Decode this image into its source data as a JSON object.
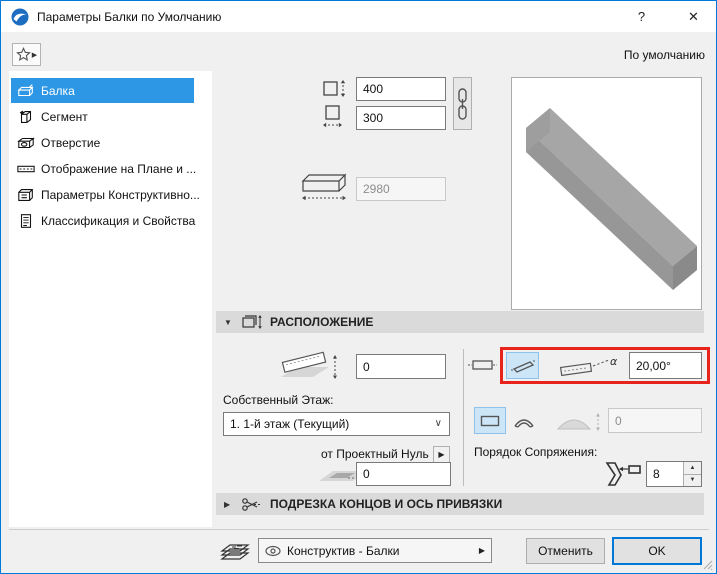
{
  "window": {
    "title": "Параметры Балки по Умолчанию",
    "help_label": "?",
    "close_label": "✕"
  },
  "toolbar": {
    "default_state_label": "По умолчанию"
  },
  "sidebar": {
    "items": [
      {
        "label": "Балка",
        "selected": true
      },
      {
        "label": "Сегмент",
        "selected": false
      },
      {
        "label": "Отверстие",
        "selected": false
      },
      {
        "label": "Отображение на Плане и ...",
        "selected": false
      },
      {
        "label": "Параметры Конструктивно...",
        "selected": false
      },
      {
        "label": "Классификация и Свойства",
        "selected": false
      }
    ]
  },
  "geometry": {
    "height_value": "400",
    "width_value": "300",
    "length_value": "2980"
  },
  "location_section": {
    "title": "РАСПОЛОЖЕНИЕ",
    "elevation_value": "0",
    "home_story_label": "Собственный Этаж:",
    "home_story_value": "1. 1-й этаж (Текущий)",
    "reference_label": "от Проектный Нуль",
    "reference_offset_value": "0",
    "slope_angle_value": "20,00°",
    "arc_height_value": "0",
    "junction_order_label": "Порядок Сопряжения:",
    "junction_order_value": "8"
  },
  "trim_section": {
    "title": "ПОДРЕЗКА КОНЦОВ И ОСЬ ПРИВЯЗКИ"
  },
  "footer": {
    "layer_value": "Конструктив - Балки",
    "cancel_label": "Отменить",
    "ok_label": "OK"
  },
  "glyphs": {
    "expanded": "▼",
    "collapsed": "▶",
    "flyout": "▶",
    "dropdown": "∨",
    "spin_up": "▲",
    "spin_down": "▼",
    "alpha": "α"
  },
  "colors": {
    "window_border": "#0079d8",
    "selection_blue": "#2e97e5",
    "highlight_red": "#e8231c",
    "toggle_blue_bg": "#cde6f7",
    "section_header_bg": "#dadada"
  }
}
